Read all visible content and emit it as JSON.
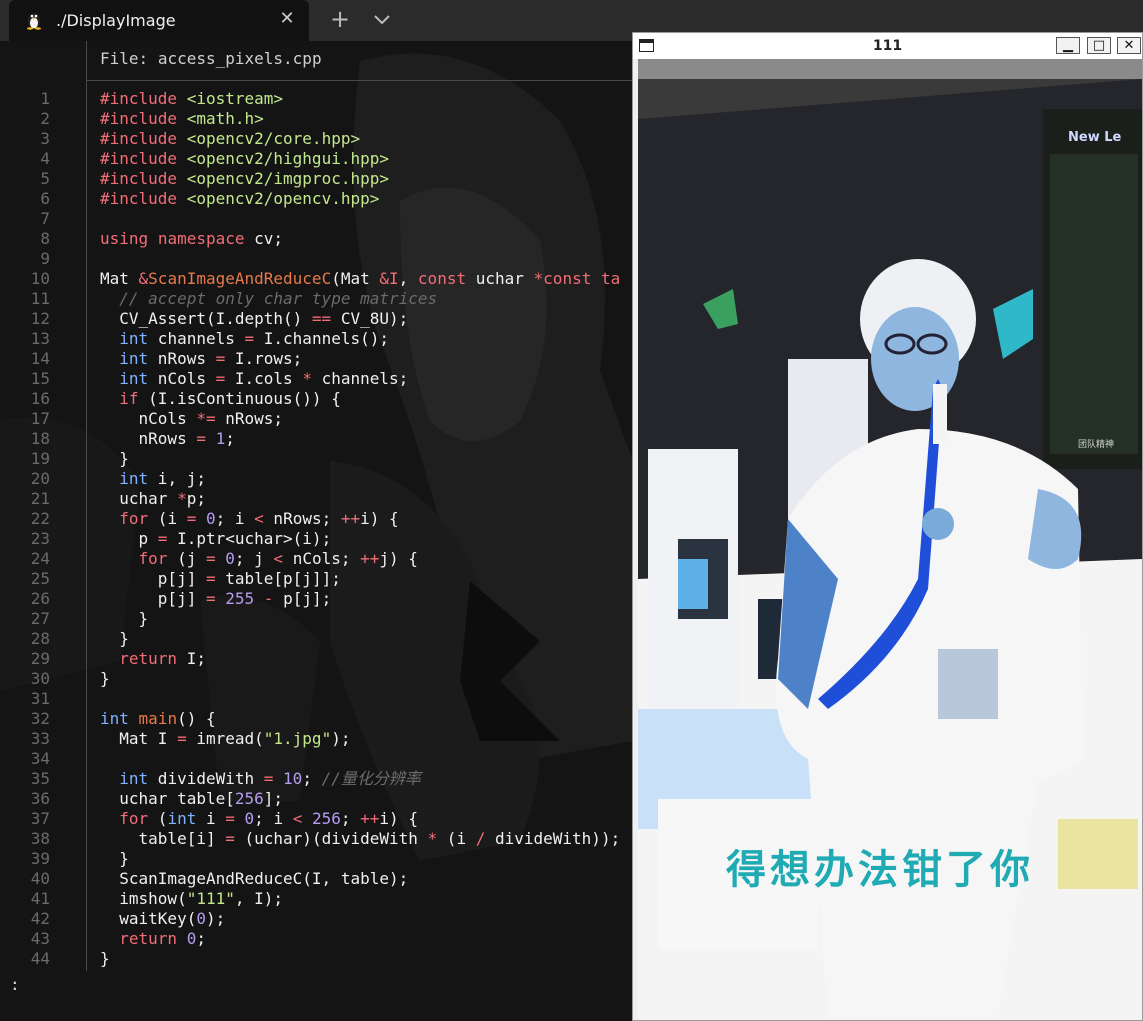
{
  "tabs": [
    {
      "title": "./DisplayImage",
      "icon": "linux-penguin-icon"
    }
  ],
  "colors": {
    "keyword": "#f26d78",
    "type": "#7fb3ff",
    "function": "#e87948",
    "number": "#b59cf0",
    "string": "#c3e88d",
    "comment": "#6b6b6b"
  },
  "editor": {
    "file_label": "File:",
    "file_name": "access_pixels.cpp",
    "prompt": ":"
  },
  "code_lines": [
    [
      [
        "k",
        "#include"
      ],
      [
        "p",
        " "
      ],
      [
        "s",
        "<iostream>"
      ]
    ],
    [
      [
        "k",
        "#include"
      ],
      [
        "p",
        " "
      ],
      [
        "s",
        "<math.h>"
      ]
    ],
    [
      [
        "k",
        "#include"
      ],
      [
        "p",
        " "
      ],
      [
        "s",
        "<opencv2/core.hpp>"
      ]
    ],
    [
      [
        "k",
        "#include"
      ],
      [
        "p",
        " "
      ],
      [
        "s",
        "<opencv2/highgui.hpp>"
      ]
    ],
    [
      [
        "k",
        "#include"
      ],
      [
        "p",
        " "
      ],
      [
        "s",
        "<opencv2/imgproc.hpp>"
      ]
    ],
    [
      [
        "k",
        "#include"
      ],
      [
        "p",
        " "
      ],
      [
        "s",
        "<opencv2/opencv.hpp>"
      ]
    ],
    [],
    [
      [
        "k",
        "using"
      ],
      [
        "p",
        " "
      ],
      [
        "k",
        "namespace"
      ],
      [
        "p",
        " cv;"
      ]
    ],
    [],
    [
      [
        "p",
        "Mat "
      ],
      [
        "o",
        "&"
      ],
      [
        "f",
        "ScanImageAndReduceC"
      ],
      [
        "p",
        "(Mat "
      ],
      [
        "o",
        "&"
      ],
      [
        "k",
        "I"
      ],
      [
        "p",
        ", "
      ],
      [
        "k",
        "const"
      ],
      [
        "p",
        " uchar "
      ],
      [
        "o",
        "*"
      ],
      [
        "k",
        "const"
      ],
      [
        "p",
        " "
      ],
      [
        "k",
        "ta"
      ]
    ],
    [
      [
        "p",
        "  "
      ],
      [
        "c",
        "// accept only char type matrices"
      ]
    ],
    [
      [
        "p",
        "  CV_Assert(I.depth() "
      ],
      [
        "o",
        "=="
      ],
      [
        "p",
        " CV_8U);"
      ]
    ],
    [
      [
        "p",
        "  "
      ],
      [
        "t",
        "int"
      ],
      [
        "p",
        " channels "
      ],
      [
        "o",
        "="
      ],
      [
        "p",
        " I.channels();"
      ]
    ],
    [
      [
        "p",
        "  "
      ],
      [
        "t",
        "int"
      ],
      [
        "p",
        " nRows "
      ],
      [
        "o",
        "="
      ],
      [
        "p",
        " I.rows;"
      ]
    ],
    [
      [
        "p",
        "  "
      ],
      [
        "t",
        "int"
      ],
      [
        "p",
        " nCols "
      ],
      [
        "o",
        "="
      ],
      [
        "p",
        " I.cols "
      ],
      [
        "o",
        "*"
      ],
      [
        "p",
        " channels;"
      ]
    ],
    [
      [
        "p",
        "  "
      ],
      [
        "k",
        "if"
      ],
      [
        "p",
        " (I.isContinuous()) {"
      ]
    ],
    [
      [
        "p",
        "    nCols "
      ],
      [
        "o",
        "*="
      ],
      [
        "p",
        " nRows;"
      ]
    ],
    [
      [
        "p",
        "    nRows "
      ],
      [
        "o",
        "="
      ],
      [
        "p",
        " "
      ],
      [
        "n",
        "1"
      ],
      [
        "p",
        ";"
      ]
    ],
    [
      [
        "p",
        "  }"
      ]
    ],
    [
      [
        "p",
        "  "
      ],
      [
        "t",
        "int"
      ],
      [
        "p",
        " i, j;"
      ]
    ],
    [
      [
        "p",
        "  uchar "
      ],
      [
        "o",
        "*"
      ],
      [
        "p",
        "p;"
      ]
    ],
    [
      [
        "p",
        "  "
      ],
      [
        "k",
        "for"
      ],
      [
        "p",
        " (i "
      ],
      [
        "o",
        "="
      ],
      [
        "p",
        " "
      ],
      [
        "n",
        "0"
      ],
      [
        "p",
        "; i "
      ],
      [
        "o",
        "<"
      ],
      [
        "p",
        " nRows; "
      ],
      [
        "o",
        "++"
      ],
      [
        "p",
        "i) {"
      ]
    ],
    [
      [
        "p",
        "    p "
      ],
      [
        "o",
        "="
      ],
      [
        "p",
        " I.ptr<uchar>(i);"
      ]
    ],
    [
      [
        "p",
        "    "
      ],
      [
        "k",
        "for"
      ],
      [
        "p",
        " (j "
      ],
      [
        "o",
        "="
      ],
      [
        "p",
        " "
      ],
      [
        "n",
        "0"
      ],
      [
        "p",
        "; j "
      ],
      [
        "o",
        "<"
      ],
      [
        "p",
        " nCols; "
      ],
      [
        "o",
        "++"
      ],
      [
        "p",
        "j) {"
      ]
    ],
    [
      [
        "p",
        "      p[j] "
      ],
      [
        "o",
        "="
      ],
      [
        "p",
        " table[p[j]];"
      ]
    ],
    [
      [
        "p",
        "      p[j] "
      ],
      [
        "o",
        "="
      ],
      [
        "p",
        " "
      ],
      [
        "n",
        "255"
      ],
      [
        "p",
        " "
      ],
      [
        "o",
        "-"
      ],
      [
        "p",
        " p[j];"
      ]
    ],
    [
      [
        "p",
        "    }"
      ]
    ],
    [
      [
        "p",
        "  }"
      ]
    ],
    [
      [
        "p",
        "  "
      ],
      [
        "k",
        "return"
      ],
      [
        "p",
        " I;"
      ]
    ],
    [
      [
        "p",
        "}"
      ]
    ],
    [],
    [
      [
        "t",
        "int"
      ],
      [
        "p",
        " "
      ],
      [
        "f",
        "main"
      ],
      [
        "p",
        "() {"
      ]
    ],
    [
      [
        "p",
        "  Mat I "
      ],
      [
        "o",
        "="
      ],
      [
        "p",
        " imread("
      ],
      [
        "s",
        "\"1.jpg\""
      ],
      [
        "p",
        ");"
      ]
    ],
    [],
    [
      [
        "p",
        "  "
      ],
      [
        "t",
        "int"
      ],
      [
        "p",
        " divideWith "
      ],
      [
        "o",
        "="
      ],
      [
        "p",
        " "
      ],
      [
        "n",
        "10"
      ],
      [
        "p",
        "; "
      ],
      [
        "c",
        "//量化分辨率"
      ]
    ],
    [
      [
        "p",
        "  uchar table["
      ],
      [
        "n",
        "256"
      ],
      [
        "p",
        "];"
      ]
    ],
    [
      [
        "p",
        "  "
      ],
      [
        "k",
        "for"
      ],
      [
        "p",
        " ("
      ],
      [
        "t",
        "int"
      ],
      [
        "p",
        " i "
      ],
      [
        "o",
        "="
      ],
      [
        "p",
        " "
      ],
      [
        "n",
        "0"
      ],
      [
        "p",
        "; i "
      ],
      [
        "o",
        "<"
      ],
      [
        "p",
        " "
      ],
      [
        "n",
        "256"
      ],
      [
        "p",
        "; "
      ],
      [
        "o",
        "++"
      ],
      [
        "p",
        "i) {"
      ]
    ],
    [
      [
        "p",
        "    table[i] "
      ],
      [
        "o",
        "="
      ],
      [
        "p",
        " (uchar)(divideWith "
      ],
      [
        "o",
        "*"
      ],
      [
        "p",
        " (i "
      ],
      [
        "o",
        "/"
      ],
      [
        "p",
        " divideWith));"
      ]
    ],
    [
      [
        "p",
        "  }"
      ]
    ],
    [
      [
        "p",
        "  ScanImageAndReduceC(I, table);"
      ]
    ],
    [
      [
        "p",
        "  imshow("
      ],
      [
        "s",
        "\"111\""
      ],
      [
        "p",
        ", I);"
      ]
    ],
    [
      [
        "p",
        "  waitKey("
      ],
      [
        "n",
        "0"
      ],
      [
        "p",
        ");"
      ]
    ],
    [
      [
        "p",
        "  "
      ],
      [
        "k",
        "return"
      ],
      [
        "p",
        " "
      ],
      [
        "n",
        "0"
      ],
      [
        "p",
        ";"
      ]
    ],
    [
      [
        "p",
        "}"
      ]
    ]
  ],
  "image_window": {
    "title": "111",
    "minimize": "▁",
    "maximize": "□",
    "close": "✕",
    "caption": "得想办法钳了你",
    "board_text": "New Le",
    "board_footer": "团队精神"
  }
}
